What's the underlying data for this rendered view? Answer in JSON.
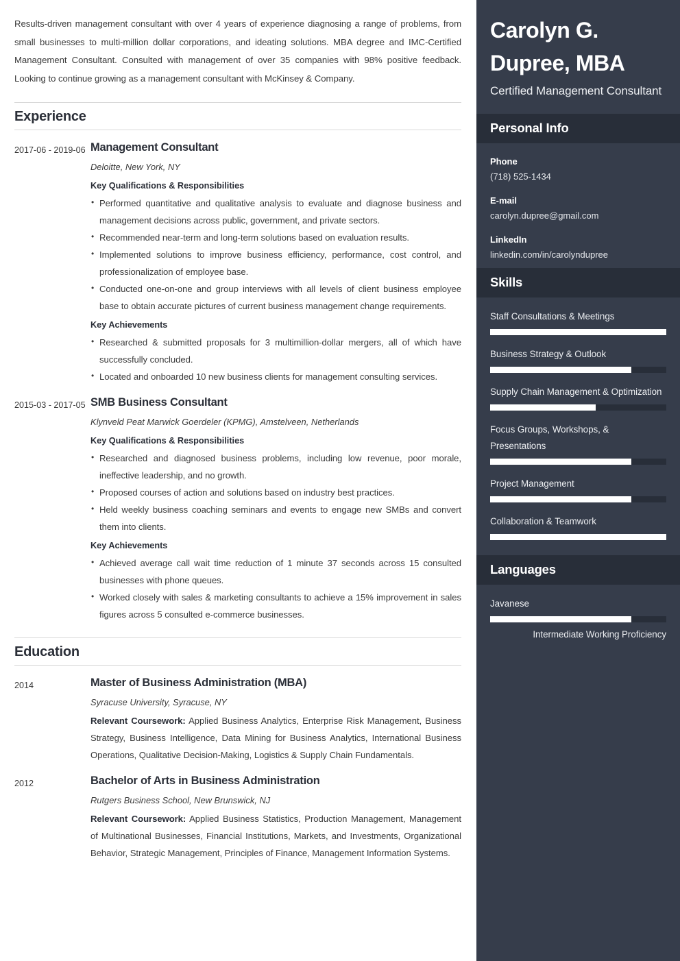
{
  "summary": "Results-driven management consultant with over 4 years of experience diagnosing a range of problems, from small businesses to multi-million dollar corporations, and ideating solutions. MBA degree and IMC-Certified Management Consultant. Consulted with management of over 35 companies with 98% positive feedback. Looking to continue growing as a management consultant with McKinsey & Company.",
  "sections": {
    "experience_title": "Experience",
    "education_title": "Education"
  },
  "experience": [
    {
      "date": "2017-06 - 2019-06",
      "title": "Management Consultant",
      "org": "Deloitte, New York, NY",
      "qual_head": "Key Qualifications & Responsibilities",
      "qualifications": [
        "Performed quantitative and qualitative analysis to evaluate and diagnose business and management decisions across public, government, and private sectors.",
        "Recommended near-term and long-term solutions based on evaluation results.",
        "Implemented solutions to improve business efficiency, performance, cost control, and professionalization of employee base.",
        "Conducted one-on-one and group interviews with all levels of client business employee base to obtain accurate pictures of current business management change requirements."
      ],
      "ach_head": "Key Achievements",
      "achievements": [
        "Researched & submitted proposals for 3 multimillion-dollar mergers, all of which have successfully concluded.",
        "Located and onboarded 10 new business clients for management consulting services."
      ]
    },
    {
      "date": "2015-03 - 2017-05",
      "title": "SMB Business Consultant",
      "org": "Klynveld Peat Marwick Goerdeler (KPMG), Amstelveen, Netherlands",
      "qual_head": "Key Qualifications & Responsibilities",
      "qualifications": [
        "Researched and diagnosed business problems, including low revenue, poor morale, ineffective leadership, and no growth.",
        "Proposed courses of action and solutions based on industry best practices.",
        "Held weekly business coaching seminars and events to engage new SMBs and convert them into clients."
      ],
      "ach_head": "Key Achievements",
      "achievements": [
        "Achieved average call wait time reduction of 1 minute 37 seconds across 15 consulted businesses with phone queues.",
        "Worked closely with sales & marketing consultants to achieve a 15% improvement in sales figures across 5 consulted e-commerce businesses."
      ]
    }
  ],
  "education": [
    {
      "date": "2014",
      "degree": "Master of Business Administration (MBA)",
      "school": "Syracuse University, Syracuse, NY",
      "coursework_label": "Relevant Coursework:",
      "coursework": " Applied Business Analytics, Enterprise Risk Management, Business Strategy, Business Intelligence, Data Mining for Business Analytics, International Business Operations, Qualitative Decision-Making, Logistics & Supply Chain Fundamentals."
    },
    {
      "date": "2012",
      "degree": "Bachelor of Arts in Business Administration",
      "school": "Rutgers Business School, New Brunswick, NJ",
      "coursework_label": "Relevant Coursework:",
      "coursework": " Applied Business Statistics, Production Management, Management of Multinational Businesses, Financial Institutions, Markets, and Investments, Organizational Behavior, Strategic Management, Principles of Finance, Management Information Systems."
    }
  ],
  "sidebar": {
    "name": "Carolyn G. Dupree, MBA",
    "role": "Certified Management Consultant",
    "personal_info": {
      "heading": "Personal Info",
      "items": [
        {
          "label": "Phone",
          "value": "(718) 525-1434"
        },
        {
          "label": "E-mail",
          "value": "carolyn.dupree@gmail.com"
        },
        {
          "label": "LinkedIn",
          "value": "linkedin.com/in/carolyndupree"
        }
      ]
    },
    "skills": {
      "heading": "Skills",
      "items": [
        {
          "label": "Staff Consultations & Meetings",
          "level": 100
        },
        {
          "label": "Business Strategy & Outlook",
          "level": 80
        },
        {
          "label": "Supply Chain Management & Optimization",
          "level": 60
        },
        {
          "label": "Focus Groups, Workshops, & Presentations",
          "level": 80
        },
        {
          "label": "Project Management",
          "level": 80
        },
        {
          "label": "Collaboration & Teamwork",
          "level": 100
        }
      ]
    },
    "languages": {
      "heading": "Languages",
      "items": [
        {
          "label": "Javanese",
          "level": 80,
          "proficiency": "Intermediate Working Proficiency"
        }
      ]
    },
    "colors": {
      "sidebar_bg": "#363d4b",
      "header_bg": "#282e39",
      "bar_fill": "#ffffff"
    }
  }
}
